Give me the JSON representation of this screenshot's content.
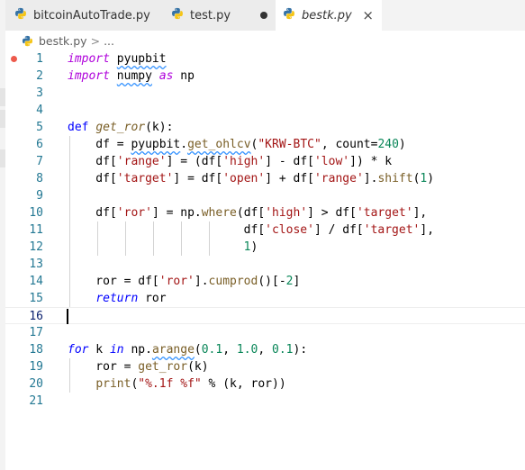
{
  "tabs": [
    {
      "name": "bitcoinAutoTrade.py",
      "state": "inactive"
    },
    {
      "name": "test.py",
      "state": "modified"
    },
    {
      "name": "bestk.py",
      "state": "active"
    }
  ],
  "tab_close_glyph": "×",
  "breadcrumb": {
    "file": "bestk.py",
    "separator": ">",
    "rest": "..."
  },
  "icons": {
    "tab_icon": "python-icon",
    "breakpoint": "breakpoint-icon"
  },
  "colors": {
    "keyword": "#0000ff",
    "control": "#af00db",
    "string": "#a31515",
    "number": "#098658",
    "function": "#795e26",
    "line_number": "#237893",
    "breakpoint": "#e51400"
  },
  "editor": {
    "current_line": 16,
    "breakpoint_line": 1,
    "lines": [
      {
        "n": "1",
        "text": "import pyupbit"
      },
      {
        "n": "2",
        "text": "import numpy as np"
      },
      {
        "n": "3",
        "text": ""
      },
      {
        "n": "4",
        "text": ""
      },
      {
        "n": "5",
        "text": "def get_ror(k):"
      },
      {
        "n": "6",
        "text": "    df = pyupbit.get_ohlcv(\"KRW-BTC\", count=240)"
      },
      {
        "n": "7",
        "text": "    df['range'] = (df['high'] - df['low']) * k"
      },
      {
        "n": "8",
        "text": "    df['target'] = df['open'] + df['range'].shift(1)"
      },
      {
        "n": "9",
        "text": ""
      },
      {
        "n": "10",
        "text": "    df['ror'] = np.where(df['high'] > df['target'],"
      },
      {
        "n": "11",
        "text": "                         df['close'] / df['target'],"
      },
      {
        "n": "12",
        "text": "                         1)"
      },
      {
        "n": "13",
        "text": ""
      },
      {
        "n": "14",
        "text": "    ror = df['ror'].cumprod()[-2]"
      },
      {
        "n": "15",
        "text": "    return ror"
      },
      {
        "n": "16",
        "text": ""
      },
      {
        "n": "17",
        "text": ""
      },
      {
        "n": "18",
        "text": "for k in np.arange(0.1, 1.0, 0.1):"
      },
      {
        "n": "19",
        "text": "    ror = get_ror(k)"
      },
      {
        "n": "20",
        "text": "    print(\"%.1f %f\" % (k, ror))"
      },
      {
        "n": "21",
        "text": ""
      }
    ]
  }
}
